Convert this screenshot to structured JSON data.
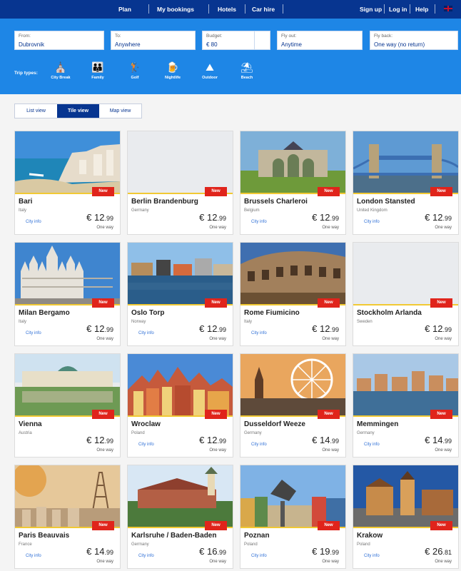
{
  "nav": {
    "items": [
      "Plan",
      "My bookings",
      "Hotels",
      "Car hire"
    ],
    "right": [
      "Sign up",
      "Log in",
      "Help"
    ]
  },
  "search": {
    "from": {
      "label": "From:",
      "value": "Dubrovnik"
    },
    "to": {
      "label": "To:",
      "value": "Anywhere"
    },
    "budget": {
      "label": "Budget:",
      "value": "€ 80"
    },
    "fly_out": {
      "label": "Fly out:",
      "value": "Anytime"
    },
    "fly_back": {
      "label": "Fly back:",
      "value": "One way (no return)"
    }
  },
  "trip_types": {
    "label": "Trip types:",
    "items": [
      {
        "label": "City Break",
        "icon": "city-break-icon"
      },
      {
        "label": "Family",
        "icon": "family-icon"
      },
      {
        "label": "Golf",
        "icon": "golf-icon"
      },
      {
        "label": "Nightlife",
        "icon": "nightlife-icon"
      },
      {
        "label": "Outdoor",
        "icon": "outdoor-icon"
      },
      {
        "label": "Beach",
        "icon": "beach-icon"
      }
    ]
  },
  "views": {
    "list": "List view",
    "tile": "Tile view",
    "map": "Map view",
    "active": "tile"
  },
  "card_common": {
    "badge": "New",
    "city_info": "City info",
    "one_way": "One way"
  },
  "cards": [
    {
      "city": "Bari",
      "country": "Italy",
      "price_int": "€ 12",
      "price_dec": ".99",
      "city_info": true
    },
    {
      "city": "Berlin Brandenburg",
      "country": "Germany",
      "price_int": "€ 12",
      "price_dec": ".99",
      "city_info": false
    },
    {
      "city": "Brussels Charleroi",
      "country": "Belgium",
      "price_int": "€ 12",
      "price_dec": ".99",
      "city_info": true
    },
    {
      "city": "London Stansted",
      "country": "United Kingdom",
      "price_int": "€ 12",
      "price_dec": ".99",
      "city_info": true
    },
    {
      "city": "Milan Bergamo",
      "country": "Italy",
      "price_int": "€ 12",
      "price_dec": ".99",
      "city_info": true
    },
    {
      "city": "Oslo Torp",
      "country": "Norway",
      "price_int": "€ 12",
      "price_dec": ".99",
      "city_info": true
    },
    {
      "city": "Rome Fiumicino",
      "country": "Italy",
      "price_int": "€ 12",
      "price_dec": ".99",
      "city_info": true
    },
    {
      "city": "Stockholm Arlanda",
      "country": "Sweden",
      "price_int": "€ 12",
      "price_dec": ".99",
      "city_info": false
    },
    {
      "city": "Vienna",
      "country": "Austria",
      "price_int": "€ 12",
      "price_dec": ".99",
      "city_info": false
    },
    {
      "city": "Wroclaw",
      "country": "Poland",
      "price_int": "€ 12",
      "price_dec": ".99",
      "city_info": true
    },
    {
      "city": "Dusseldorf Weeze",
      "country": "Germany",
      "price_int": "€ 14",
      "price_dec": ".99",
      "city_info": true
    },
    {
      "city": "Memmingen",
      "country": "Germany",
      "price_int": "€ 14",
      "price_dec": ".99",
      "city_info": true
    },
    {
      "city": "Paris Beauvais",
      "country": "France",
      "price_int": "€ 14",
      "price_dec": ".99",
      "city_info": true
    },
    {
      "city": "Karlsruhe / Baden-Baden",
      "country": "Germany",
      "price_int": "€ 16",
      "price_dec": ".99",
      "city_info": true
    },
    {
      "city": "Poznan",
      "country": "Poland",
      "price_int": "€ 19",
      "price_dec": ".99",
      "city_info": true
    },
    {
      "city": "Krakow",
      "country": "Poland",
      "price_int": "€ 26",
      "price_dec": ".81",
      "city_info": true
    }
  ]
}
